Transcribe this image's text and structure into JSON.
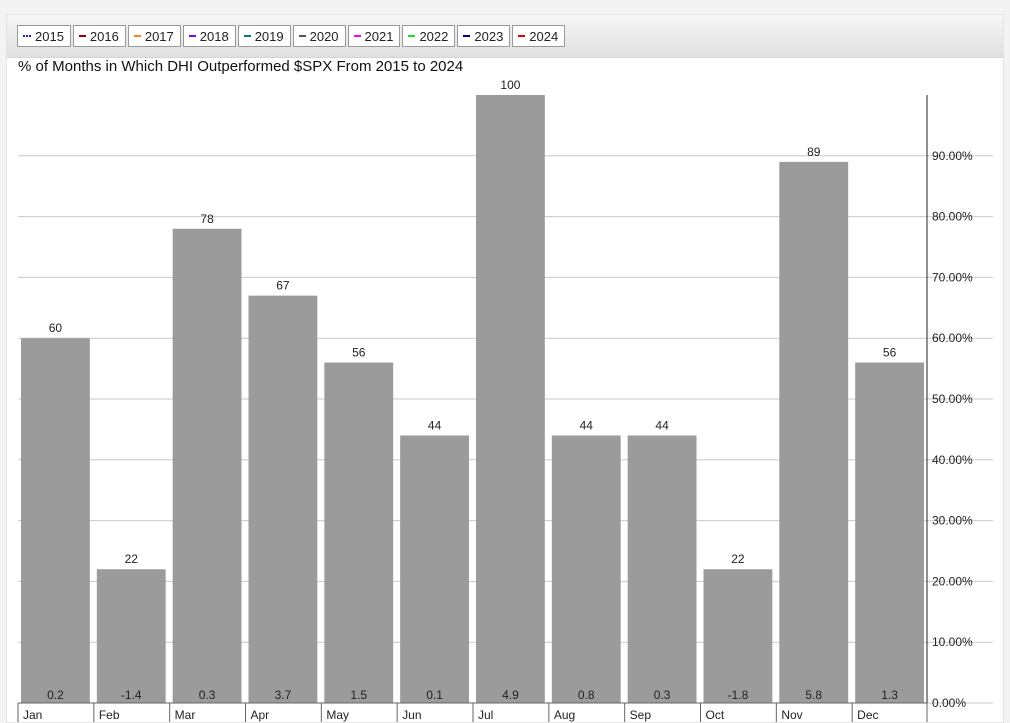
{
  "legend": {
    "items": [
      {
        "label": "2015",
        "color": "#1f1fb4",
        "style": "dotted"
      },
      {
        "label": "2016",
        "color": "#a00000",
        "style": "solid"
      },
      {
        "label": "2017",
        "color": "#ff7f27",
        "style": "solid"
      },
      {
        "label": "2018",
        "color": "#8000ff",
        "style": "solid"
      },
      {
        "label": "2019",
        "color": "#008080",
        "style": "solid"
      },
      {
        "label": "2020",
        "color": "#555555",
        "style": "solid"
      },
      {
        "label": "2021",
        "color": "#ff00ff",
        "style": "solid"
      },
      {
        "label": "2022",
        "color": "#22dd22",
        "style": "solid"
      },
      {
        "label": "2023",
        "color": "#000080",
        "style": "solid"
      },
      {
        "label": "2024",
        "color": "#e00000",
        "style": "solid"
      }
    ]
  },
  "chart_data": {
    "type": "bar",
    "title": "% of Months in Which DHI Outperformed $SPX From 2015 to 2024",
    "categories": [
      "Jan",
      "Feb",
      "Mar",
      "Apr",
      "May",
      "Jun",
      "Jul",
      "Aug",
      "Sep",
      "Oct",
      "Nov",
      "Dec"
    ],
    "values": [
      60,
      22,
      78,
      67,
      56,
      44,
      100,
      44,
      44,
      22,
      89,
      56
    ],
    "bottom_labels": [
      "0.2",
      "-1.4",
      "0.3",
      "3.7",
      "1.5",
      "0.1",
      "4.9",
      "0.8",
      "0.3",
      "-1.8",
      "5.8",
      "1.3"
    ],
    "yticks": [
      "0.00%",
      "10.00%",
      "20.00%",
      "30.00%",
      "40.00%",
      "50.00%",
      "60.00%",
      "70.00%",
      "80.00%",
      "90.00%"
    ],
    "ylim": [
      0,
      100
    ],
    "yaxis_side": "right",
    "grid": true,
    "bar_color": "#9b9b9b"
  }
}
